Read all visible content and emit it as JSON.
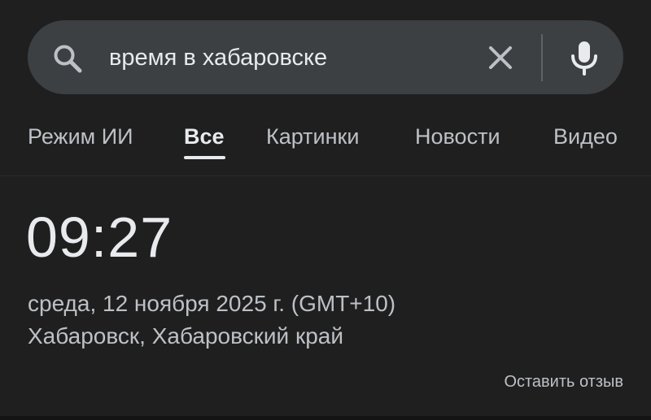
{
  "search": {
    "query": "время в хабаровске"
  },
  "tabs": [
    {
      "label": "Режим ИИ",
      "active": false
    },
    {
      "label": "Все",
      "active": true
    },
    {
      "label": "Картинки",
      "active": false
    },
    {
      "label": "Новости",
      "active": false
    },
    {
      "label": "Видео",
      "active": false
    }
  ],
  "result": {
    "time": "09:27",
    "date": "среда, 12 ноября 2025 г. (GMT+10)",
    "location": "Хабаровск, Хабаровский край",
    "feedback_label": "Оставить отзыв"
  },
  "colors": {
    "background": "#1f1f1f",
    "search_bar": "#3c4043",
    "primary_text": "#e8eaed",
    "secondary_text": "#bdc1c6"
  },
  "icons": {
    "search": "search-icon",
    "clear": "close-icon",
    "voice": "microphone-icon"
  }
}
